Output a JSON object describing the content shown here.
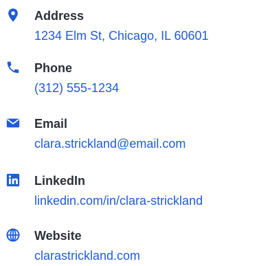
{
  "accent_color": "#1f5cd6",
  "label_color": "#2b2f38",
  "contacts": [
    {
      "icon": "location-pin-icon",
      "label": "Address",
      "value": "1234 Elm St, Chicago, IL 60601"
    },
    {
      "icon": "phone-icon",
      "label": "Phone",
      "value": "(312) 555-1234"
    },
    {
      "icon": "envelope-icon",
      "label": "Email",
      "value": "clara.strickland@email.com"
    },
    {
      "icon": "linkedin-icon",
      "label": "LinkedIn",
      "value": "linkedin.com/in/clara-strickland"
    },
    {
      "icon": "globe-icon",
      "label": "Website",
      "value": "clarastrickland.com"
    }
  ]
}
